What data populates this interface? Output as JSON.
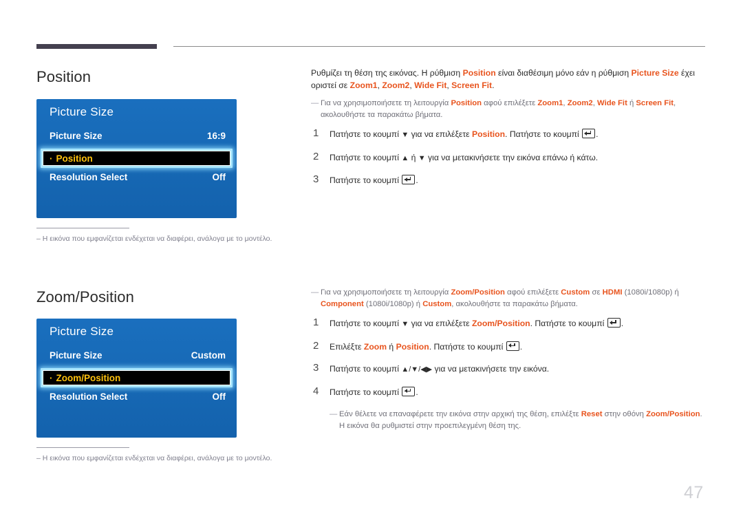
{
  "page": {
    "number": "47"
  },
  "sections": [
    {
      "title": "Position",
      "osd": {
        "title": "Picture Size",
        "rows": [
          {
            "label": "Picture Size",
            "value": "16:9"
          },
          {
            "label": "Resolution Select",
            "value": "Off"
          }
        ],
        "selected": {
          "dot": "·",
          "label": "Position"
        }
      },
      "footnote": {
        "dash": "–",
        "text": "Η εικόνα που εμφανίζεται ενδέχεται να διαφέρει, ανάλογα με το μοντέλο."
      },
      "intro": {
        "t1": "Ρυθμίζει τη θέση της εικόνας. Η ρύθμιση ",
        "h1": "Position",
        "t2": " είναι διαθέσιμη μόνο εάν η ρύθμιση ",
        "h2": "Picture Size",
        "t3": " έχει οριστεί σε ",
        "h3": "Zoom1",
        "t4": ", ",
        "h4": "Zoom2",
        "t5": ", ",
        "h5": "Wide Fit",
        "t6": ", ",
        "h6": "Screen Fit",
        "t7": "."
      },
      "note": {
        "dash": "—",
        "t1": "Για να χρησιμοποιήσετε τη λειτουργία ",
        "h1": "Position",
        "t2": " αφού επιλέξετε ",
        "h2": "Zoom1",
        "t3": ", ",
        "h3": "Zoom2",
        "t4": ", ",
        "h4": "Wide Fit",
        "t5": " ή ",
        "h5": "Screen Fit",
        "t6": ", ακολουθήστε τα παρακάτω βήματα."
      },
      "steps": [
        {
          "num": "1",
          "t1": "Πατήστε το κουμπί ",
          "arrow": "▼",
          "t2": " για να επιλέξετε ",
          "h1": "Position",
          "t3": ". Πατήστε το κουμπί ",
          "t4": "."
        },
        {
          "num": "2",
          "t1": "Πατήστε το κουμπί ",
          "arrow": "▲",
          "t2": " ή ",
          "arrow2": "▼",
          "t3": " για να μετακινήσετε την εικόνα επάνω ή κάτω."
        },
        {
          "num": "3",
          "t1": "Πατήστε το κουμπί ",
          "t2": "."
        }
      ]
    },
    {
      "title": "Zoom/Position",
      "osd": {
        "title": "Picture Size",
        "rows": [
          {
            "label": "Picture Size",
            "value": "Custom"
          },
          {
            "label": "Resolution Select",
            "value": "Off"
          }
        ],
        "selected": {
          "dot": "·",
          "label": "Zoom/Position"
        }
      },
      "footnote": {
        "dash": "–",
        "text": "Η εικόνα που εμφανίζεται ενδέχεται να διαφέρει, ανάλογα με το μοντέλο."
      },
      "note": {
        "dash": "—",
        "t1": "Για να χρησιμοποιήσετε τη λειτουργία ",
        "h1": "Zoom/Position",
        "t2": " αφού επιλέξετε ",
        "h2": "Custom",
        "t3": " σε ",
        "h3": "HDMI",
        "t4": " (1080i/1080p) ή ",
        "h4": "Component",
        "t5": " (1080i/1080p) ή ",
        "h5": "Custom",
        "t6": ", ακολουθήστε τα παρακάτω βήματα."
      },
      "steps": [
        {
          "num": "1",
          "t1": "Πατήστε το κουμπί ",
          "arrow": "▼",
          "t2": " για να επιλέξετε ",
          "h1": "Zoom/Position",
          "t3": ". Πατήστε το κουμπί ",
          "t4": "."
        },
        {
          "num": "2",
          "t1": "Επιλέξτε ",
          "h1": "Zoom",
          "t2": " ή ",
          "h2": "Position",
          "t3": ". Πατήστε το κουμπί ",
          "t4": "."
        },
        {
          "num": "3",
          "t1": "Πατήστε το κουμπί ",
          "arrows": "▲/▼/◀▶",
          "t2": " για να μετακινήσετε την εικόνα."
        },
        {
          "num": "4",
          "t1": "Πατήστε το κουμπί ",
          "t2": "."
        }
      ],
      "endnote": {
        "dash": "—",
        "t1": "Εάν θέλετε να επαναφέρετε την εικόνα στην αρχική της θέση, επιλέξτε ",
        "h1": "Reset",
        "t2": " στην οθόνη ",
        "h2": "Zoom/Position",
        "t3": ". Η εικόνα θα ρυθμιστεί στην προεπιλεγμένη θέση της."
      }
    }
  ]
}
